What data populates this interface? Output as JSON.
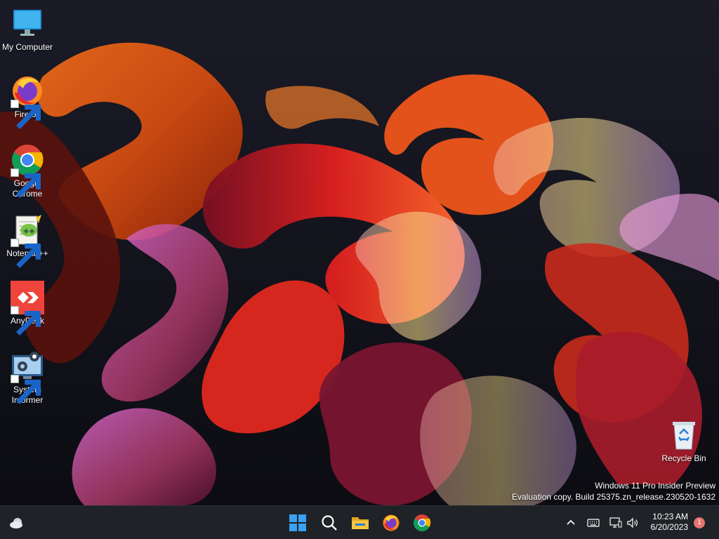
{
  "desktop": {
    "icons": [
      {
        "label": "My Computer",
        "icon": "monitor-icon"
      },
      {
        "label": "Firefox",
        "icon": "firefox-icon"
      },
      {
        "label": "Google Chrome",
        "icon": "chrome-icon"
      },
      {
        "label": "Notepad++",
        "icon": "notepad-plus-plus-icon"
      },
      {
        "label": "AnyDesk",
        "icon": "anydesk-icon"
      },
      {
        "label": "System Informer",
        "icon": "system-informer-icon"
      },
      {
        "label": "Recycle Bin",
        "icon": "recycle-bin-icon"
      }
    ],
    "watermark": {
      "line1": "Windows 11 Pro Insider Preview",
      "line2": "Evaluation copy. Build 25375.zn_release.230520-1632"
    }
  },
  "taskbar": {
    "widgets_icon": "weather-icon",
    "pinned": [
      {
        "name": "start-button",
        "icon": "windows-logo-icon"
      },
      {
        "name": "search-button",
        "icon": "search-icon"
      },
      {
        "name": "file-explorer-button",
        "icon": "folder-icon"
      },
      {
        "name": "firefox-taskbar-button",
        "icon": "firefox-icon"
      },
      {
        "name": "chrome-taskbar-button",
        "icon": "chrome-icon"
      }
    ],
    "tray": {
      "time": "10:23 AM",
      "date": "6/20/2023",
      "notification_count": "1"
    }
  },
  "colors": {
    "taskbar_bg": "#1f2226",
    "wallpaper_bg": "#14141c",
    "badge": "#e5736f"
  }
}
